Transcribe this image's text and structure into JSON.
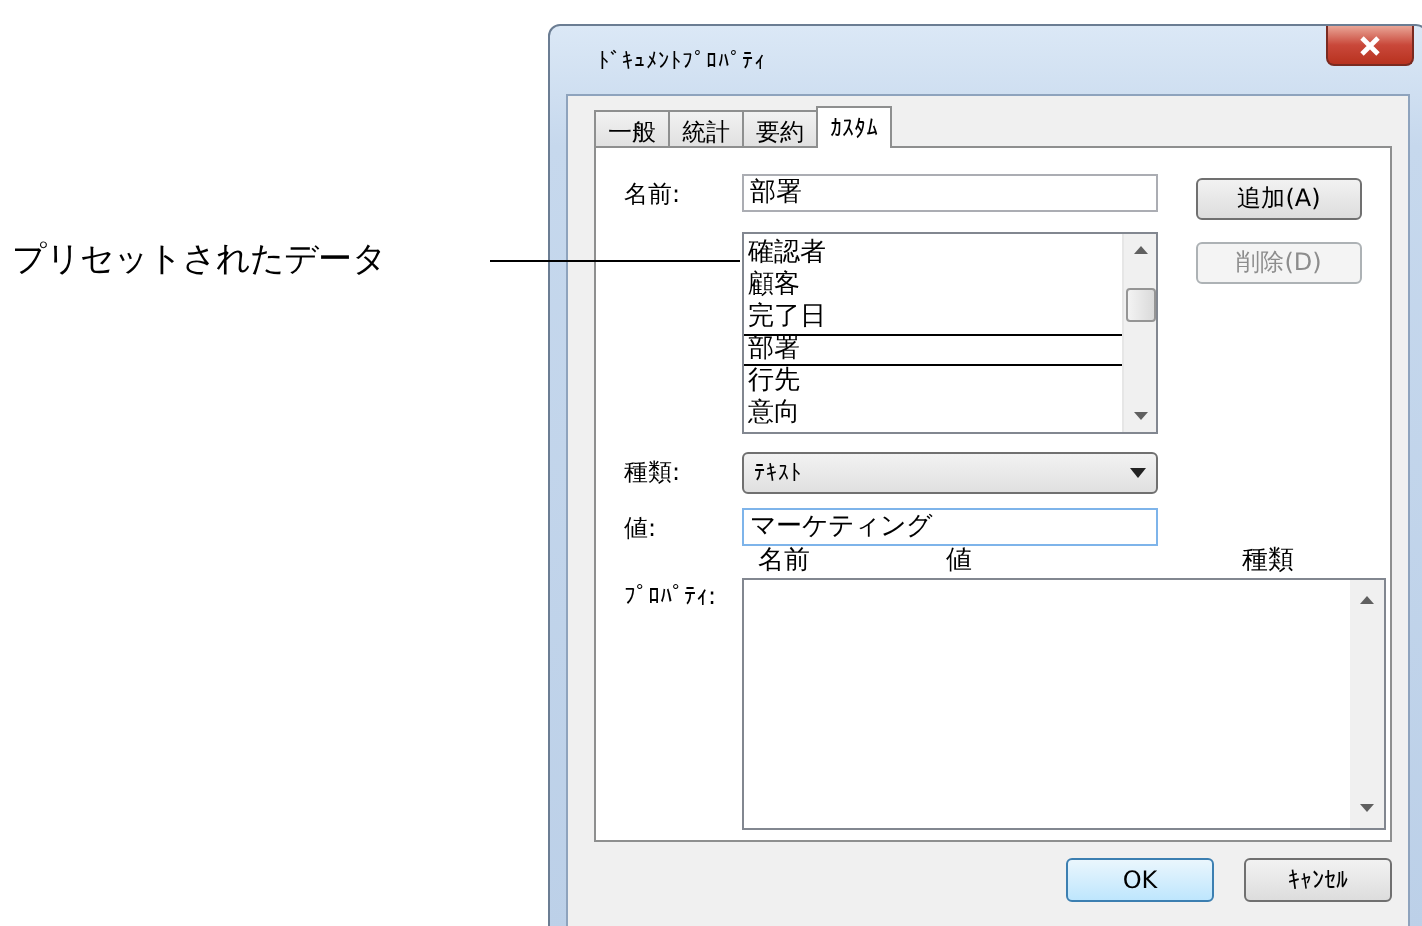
{
  "window": {
    "title": "ﾄﾞｷｭﾒﾝﾄﾌﾟﾛﾊﾟﾃｨ"
  },
  "tabs": [
    {
      "label": "一般",
      "selected": false
    },
    {
      "label": "統計",
      "selected": false
    },
    {
      "label": "要約",
      "selected": false
    },
    {
      "label": "ｶｽﾀﾑ",
      "selected": true
    }
  ],
  "name_field": {
    "label": "名前:",
    "value": "部署"
  },
  "buttons": [
    {
      "label": "追加(A)",
      "disabled": false
    },
    {
      "label": "削除(D)",
      "disabled": true
    }
  ],
  "preset_list": {
    "items": [
      {
        "label": "確認者",
        "selected": false
      },
      {
        "label": "顧客",
        "selected": false
      },
      {
        "label": "完了日",
        "selected": false
      },
      {
        "label": "部署",
        "selected": true
      },
      {
        "label": "行先",
        "selected": false
      },
      {
        "label": "意向",
        "selected": false
      }
    ]
  },
  "type_field": {
    "label": "種類:",
    "value": "ﾃｷｽﾄ"
  },
  "value_field": {
    "label": "値:",
    "value": "マーケティング"
  },
  "properties": {
    "label": "ﾌﾟﾛﾊﾟﾃｨ:",
    "columns": [
      "名前",
      "値",
      "種類"
    ]
  },
  "dialog_buttons": [
    {
      "label": "OK",
      "default": true
    },
    {
      "label": "ｷｬﾝｾﾙ",
      "default": false
    }
  ],
  "annotation": {
    "text": "プリセットされたデータ"
  }
}
